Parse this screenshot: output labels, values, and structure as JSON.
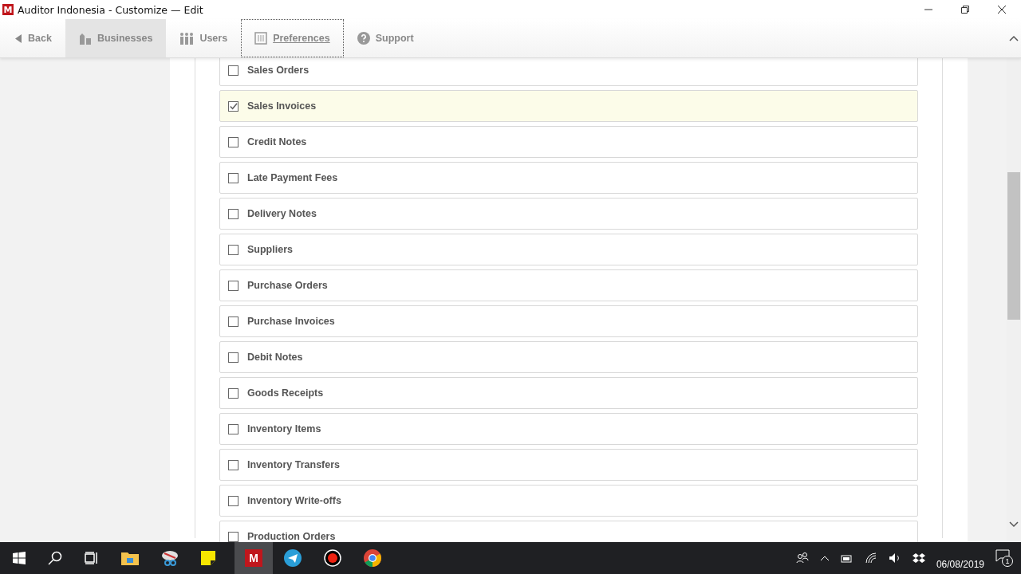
{
  "window": {
    "title": "Auditor Indonesia - Customize — Edit",
    "app_letter": "M"
  },
  "toolbar": [
    {
      "label": "Back",
      "kind": "back",
      "selected": false,
      "focused": false
    },
    {
      "label": "Businesses",
      "kind": "businesses",
      "selected": true,
      "focused": false
    },
    {
      "label": "Users",
      "kind": "users",
      "selected": false,
      "focused": false
    },
    {
      "label": "Preferences",
      "kind": "preferences",
      "selected": false,
      "focused": true
    },
    {
      "label": "Support",
      "kind": "support",
      "selected": false,
      "focused": false
    }
  ],
  "modules": [
    {
      "label": "Sales Orders",
      "checked": false
    },
    {
      "label": "Sales Invoices",
      "checked": true
    },
    {
      "label": "Credit Notes",
      "checked": false
    },
    {
      "label": "Late Payment Fees",
      "checked": false
    },
    {
      "label": "Delivery Notes",
      "checked": false
    },
    {
      "label": "Suppliers",
      "checked": false
    },
    {
      "label": "Purchase Orders",
      "checked": false
    },
    {
      "label": "Purchase Invoices",
      "checked": false
    },
    {
      "label": "Debit Notes",
      "checked": false
    },
    {
      "label": "Goods Receipts",
      "checked": false
    },
    {
      "label": "Inventory Items",
      "checked": false
    },
    {
      "label": "Inventory Transfers",
      "checked": false
    },
    {
      "label": "Inventory Write-offs",
      "checked": false
    },
    {
      "label": "Production Orders",
      "checked": false
    }
  ],
  "taskbar": {
    "app_letter": "M",
    "date": "06/08/2019",
    "notifications": "1"
  }
}
